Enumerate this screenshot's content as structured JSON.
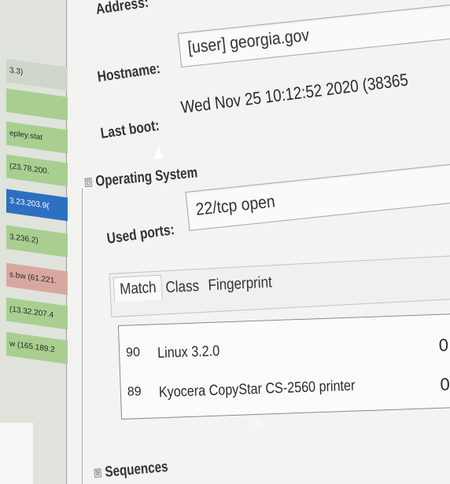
{
  "left_list": {
    "items": [
      {
        "text": "3.3)",
        "style": "plain"
      },
      {
        "text": "",
        "style": "green"
      },
      {
        "text": "epley.stat",
        "style": "green"
      },
      {
        "text": "(23.78.200.",
        "style": "green"
      },
      {
        "text": "3.23.203.9(",
        "style": "selected"
      },
      {
        "text": "3.236.2)",
        "style": "green"
      },
      {
        "text": "s.bw (61.221.",
        "style": "red"
      },
      {
        "text": "(13.32.207.4",
        "style": "green"
      },
      {
        "text": "w (165.189.2",
        "style": "green"
      }
    ]
  },
  "details": {
    "address_label": "Address:",
    "hostname_label": "Hostname:",
    "hostname_value": "[user] georgia.gov",
    "last_boot_label": "Last boot:",
    "last_boot_value": "Wed Nov 25 10:12:52 2020 (38365",
    "os_section": "Operating System",
    "used_ports_label": "Used ports:",
    "used_ports_value": "22/tcp open",
    "sequences_section": "Sequences",
    "collapse_glyph": "⊟",
    "expand_glyph": "⊞"
  },
  "os_tabs": [
    {
      "label": "Match",
      "active": true
    },
    {
      "label": "Class",
      "active": false
    },
    {
      "label": "Fingerprint",
      "active": false
    }
  ],
  "os_matches": [
    {
      "accuracy": "90",
      "name": "Linux 3.2.0",
      "line": "0"
    },
    {
      "accuracy": "89",
      "name": "Kyocera CopyStar CS-2560 printer",
      "line": "0"
    }
  ]
}
